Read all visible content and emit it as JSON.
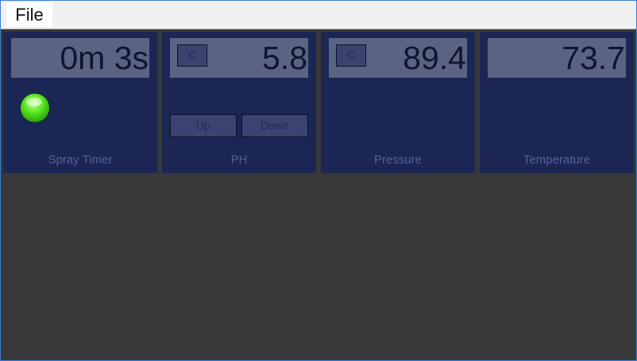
{
  "menu": {
    "file_label": "File"
  },
  "panels": {
    "spray_timer": {
      "value": "0m 3s",
      "label": "Spray Timer",
      "indicator": "green-led"
    },
    "ph": {
      "value": "5.8",
      "label": "PH",
      "c_label": "C",
      "up_label": "Up",
      "down_label": "Down"
    },
    "pressure": {
      "value": "89.4",
      "label": "Pressure",
      "c_label": "C"
    },
    "temperature": {
      "value": "73.7",
      "label": "Temperature"
    }
  },
  "colors": {
    "panel_bg": "#1b2654",
    "display_bg": "#5b6383",
    "window_bg": "#383838",
    "label_text": "#56609a",
    "led": "#4cd818"
  }
}
